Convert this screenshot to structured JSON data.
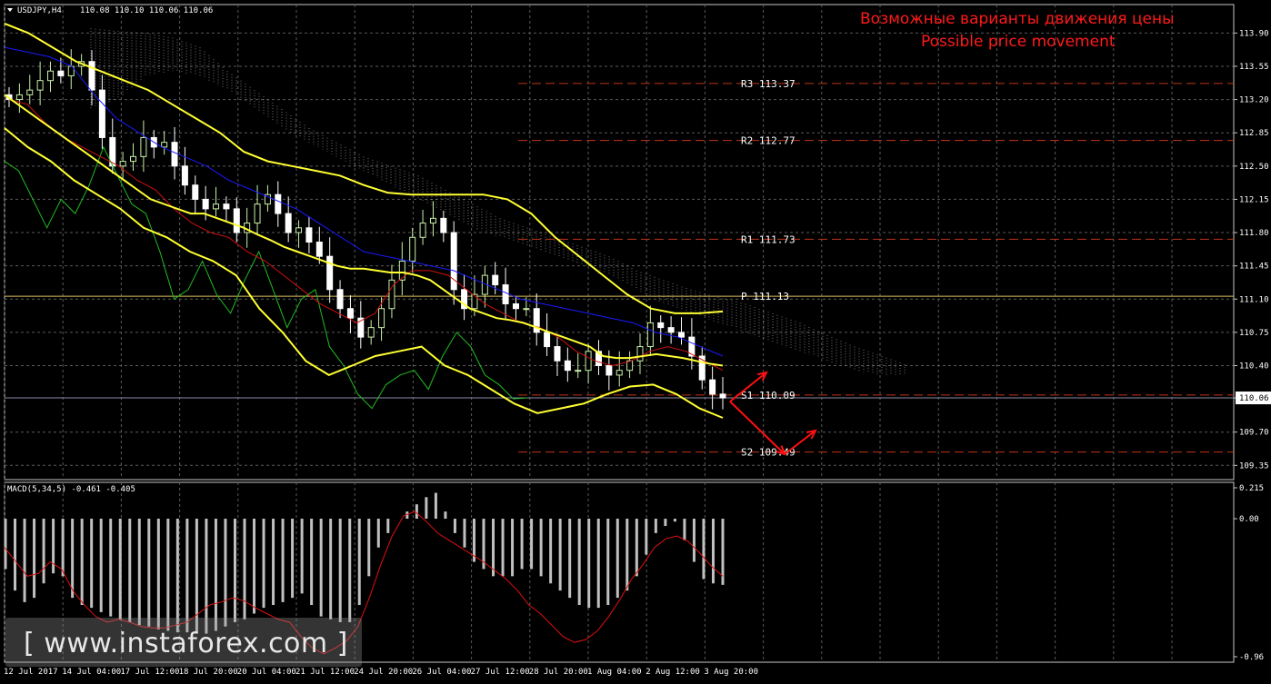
{
  "header": {
    "symbol_label": "USDJPY,H4",
    "ohlc": "110.08 110.10 110.06 110.06",
    "title_ru": "Возможные варианты движения цены",
    "title_en": "Possible price movement"
  },
  "watermark": "[ www.instaforex.com ]",
  "colors": {
    "background": "#000000",
    "grid": "#5a5a5a",
    "bull_candle": "#c8f0a8",
    "bear_candle": "#ffffff",
    "bollinger": "#ffff33",
    "ma_red": "#d01010",
    "ma_blue": "#1a1aff",
    "chikou_green": "#22bb22",
    "cloud": "#ffffff",
    "level_lines": "#c03418",
    "pivot_line": "#e0c060",
    "arrows": "#ff1010",
    "macd_hist": "#c0c0c0",
    "macd_signal": "#e01010",
    "label_text": "#ffffff",
    "annotation_red": "#ff1a1a"
  },
  "chart_data": [
    {
      "type": "candlestick",
      "name": "price",
      "title": "USDJPY,H4",
      "ylim": [
        109.2,
        114.2
      ],
      "y_ticks": [
        "113.90",
        "113.55",
        "113.20",
        "112.85",
        "112.50",
        "112.15",
        "111.80",
        "111.45",
        "111.10",
        "110.75",
        "110.40",
        "110.06",
        "109.70",
        "109.35"
      ],
      "x_ticks": [
        "12 Jul 2017",
        "14 Jul 04:00",
        "17 Jul 12:00",
        "18 Jul 20:00",
        "20 Jul 04:00",
        "21 Jul 12:00",
        "24 Jul 20:00",
        "26 Jul 04:00",
        "27 Jul 12:00",
        "28 Jul 20:00",
        "1 Aug 04:00",
        "2 Aug 12:00",
        "3 Aug 20:00"
      ],
      "current_price": 110.06,
      "levels": [
        {
          "label": "R3 113.37",
          "value": 113.37
        },
        {
          "label": "R2 112.77",
          "value": 112.77
        },
        {
          "label": "R1 111.73",
          "value": 111.73
        },
        {
          "label": "P 111.13",
          "value": 111.13
        },
        {
          "label": "S1 110.09",
          "value": 110.09
        },
        {
          "label": "S2 109.49",
          "value": 109.49
        }
      ],
      "closes": [
        113.2,
        113.25,
        113.3,
        113.4,
        113.5,
        113.45,
        113.55,
        113.6,
        113.3,
        112.8,
        112.5,
        112.55,
        112.6,
        112.8,
        112.7,
        112.75,
        112.5,
        112.3,
        112.15,
        112.05,
        112.1,
        112.05,
        111.8,
        111.9,
        112.1,
        112.2,
        112.0,
        111.8,
        111.85,
        111.7,
        111.55,
        111.2,
        111.0,
        110.9,
        110.7,
        110.8,
        111.0,
        111.3,
        111.5,
        111.75,
        111.9,
        111.95,
        111.8,
        111.2,
        111.0,
        111.15,
        111.35,
        111.25,
        111.05,
        111.0,
        111.0,
        110.75,
        110.6,
        110.45,
        110.35,
        110.35,
        110.55,
        110.4,
        110.3,
        110.35,
        110.45,
        110.6,
        110.85,
        110.8,
        110.75,
        110.7,
        110.5,
        110.25,
        110.1,
        110.06
      ],
      "bollinger_mid": [
        113.25,
        113.15,
        113.05,
        112.95,
        112.85,
        112.75,
        112.65,
        112.55,
        112.45,
        112.35,
        112.25,
        112.15,
        112.1,
        112.05,
        112.0,
        112.0,
        111.95,
        111.9,
        111.85,
        111.78,
        111.72,
        111.65,
        111.6,
        111.55,
        111.5,
        111.45,
        111.42,
        111.42,
        111.4,
        111.38,
        111.38,
        111.35,
        111.3,
        111.2,
        111.1,
        111.0,
        110.95,
        110.9,
        110.88,
        110.85,
        110.8,
        110.75,
        110.7,
        110.65,
        110.6,
        110.5,
        110.48,
        110.48,
        110.5,
        110.52,
        110.5,
        110.48,
        110.45,
        110.42,
        110.4
      ],
      "bollinger_upper": [
        114.0,
        113.9,
        113.75,
        113.6,
        113.5,
        113.4,
        113.3,
        113.15,
        113.0,
        112.85,
        112.65,
        112.55,
        112.5,
        112.45,
        112.4,
        112.3,
        112.22,
        112.2,
        112.2,
        112.2,
        112.2,
        112.15,
        112.0,
        111.75,
        111.55,
        111.35,
        111.15,
        111.0,
        110.95,
        110.95,
        110.97
      ],
      "bollinger_lower": [
        112.9,
        112.7,
        112.55,
        112.35,
        112.2,
        112.05,
        111.85,
        111.75,
        111.6,
        111.5,
        111.35,
        111.0,
        110.75,
        110.45,
        110.3,
        110.4,
        110.5,
        110.55,
        110.6,
        110.4,
        110.3,
        110.15,
        110.0,
        109.9,
        109.95,
        110.0,
        110.1,
        110.18,
        110.2,
        110.1,
        109.95,
        109.85
      ]
    },
    {
      "type": "bar",
      "name": "macd",
      "title": "MACD(5,34,5) -0.461 -0.405",
      "ylim": [
        -0.96,
        0.215
      ],
      "y_ticks": [
        "0.215",
        "0.00",
        "-0.96"
      ],
      "histogram": [
        -0.35,
        -0.5,
        -0.58,
        -0.55,
        -0.45,
        -0.38,
        -0.4,
        -0.55,
        -0.6,
        -0.62,
        -0.65,
        -0.68,
        -0.7,
        -0.72,
        -0.74,
        -0.75,
        -0.77,
        -0.78,
        -0.79,
        -0.79,
        -0.8,
        -0.8,
        -0.78,
        -0.75,
        -0.72,
        -0.7,
        -0.66,
        -0.62,
        -0.6,
        -0.58,
        -0.55,
        -0.52,
        -0.6,
        -0.68,
        -0.7,
        -0.72,
        -0.72,
        -0.6,
        -0.4,
        -0.2,
        -0.1,
        0.0,
        0.05,
        0.1,
        0.15,
        0.18,
        0.05,
        -0.1,
        -0.2,
        -0.3,
        -0.35,
        -0.4,
        -0.4,
        -0.4,
        -0.35,
        -0.35,
        -0.4,
        -0.45,
        -0.5,
        -0.55,
        -0.6,
        -0.62,
        -0.62,
        -0.6,
        -0.55,
        -0.5,
        -0.4,
        -0.25,
        -0.1,
        -0.05,
        -0.02,
        -0.15,
        -0.3,
        -0.42,
        -0.45,
        -0.46
      ],
      "signal": [
        -0.2,
        -0.3,
        -0.4,
        -0.38,
        -0.3,
        -0.35,
        -0.5,
        -0.6,
        -0.68,
        -0.72,
        -0.7,
        -0.72,
        -0.75,
        -0.76,
        -0.76,
        -0.74,
        -0.72,
        -0.66,
        -0.6,
        -0.58,
        -0.55,
        -0.57,
        -0.62,
        -0.66,
        -0.7,
        -0.72,
        -0.82,
        -0.9,
        -0.94,
        -0.9,
        -0.85,
        -0.75,
        -0.55,
        -0.32,
        -0.12,
        0.02,
        0.05,
        -0.02,
        -0.1,
        -0.15,
        -0.2,
        -0.25,
        -0.3,
        -0.36,
        -0.42,
        -0.5,
        -0.6,
        -0.66,
        -0.74,
        -0.82,
        -0.86,
        -0.84,
        -0.78,
        -0.68,
        -0.56,
        -0.42,
        -0.32,
        -0.2,
        -0.14,
        -0.12,
        -0.16,
        -0.24,
        -0.33,
        -0.4
      ]
    }
  ]
}
